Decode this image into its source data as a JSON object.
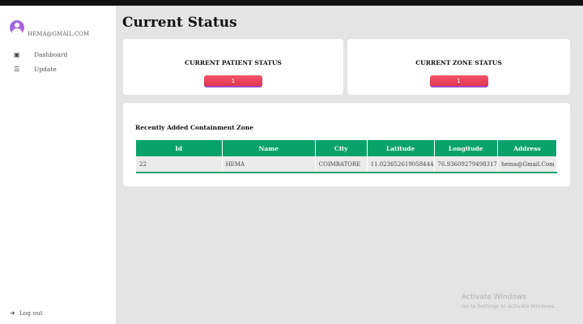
{
  "user": {
    "email": "HEMA@GMAIL.COM"
  },
  "nav": {
    "items": [
      {
        "label": "Dashboard",
        "icon": "monitor-icon"
      },
      {
        "label": "Update",
        "icon": "list-icon"
      }
    ],
    "logout": "Log out"
  },
  "page": {
    "title": "Current Status"
  },
  "patient_status": {
    "title": "CURRENT PATIENT STATUS",
    "value": "1"
  },
  "zone_status": {
    "title": "CURRENT ZONE STATUS",
    "value": "1"
  },
  "table": {
    "title": "Recently Added Containment Zone",
    "columns": [
      "Id",
      "Name",
      "City",
      "Latitude",
      "Longitude",
      "Address"
    ],
    "rows": [
      [
        "22",
        "HEMA",
        "COIMBATORE",
        "11.023652619058444",
        "76.93609279498317",
        "hema@Gmail.Com"
      ]
    ]
  },
  "watermark": {
    "line1": "Activate Windows",
    "line2": "Go to Settings to activate Windows."
  },
  "colors": {
    "accent_green": "#0aa26b",
    "status_red": "#e03850",
    "avatar_purple": "#8a6de0"
  }
}
